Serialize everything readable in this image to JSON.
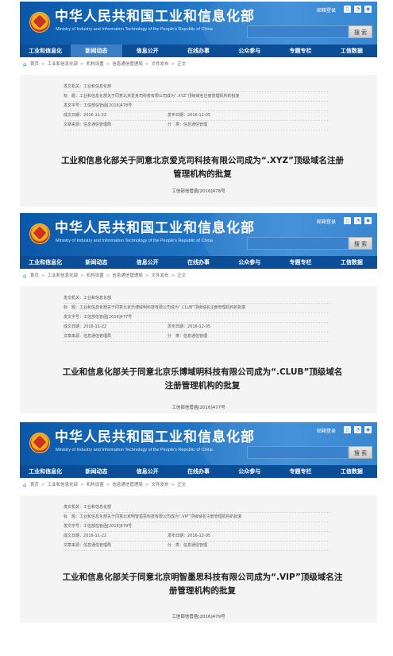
{
  "site": {
    "title": "中华人民共和国工业和信息化部",
    "subtitle": "Ministry of Industry and Information Technology of the People's Republic of China",
    "login": "邮箱登录",
    "search_label": "搜 索",
    "tool_icons": [
      "mobile-icon",
      "rss-icon",
      "weibo-icon"
    ]
  },
  "nav": {
    "items": [
      "工业和信息化",
      "新闻动态",
      "信息公开",
      "在线办事",
      "公众参与",
      "专题专栏",
      "工信数据"
    ]
  },
  "breadcrumb": [
    "首页",
    "工业和信息化部",
    "机构设置",
    "信息通信管理局",
    "文件发布",
    "正文"
  ],
  "labels": {
    "issuer": "发文机关：",
    "subject": "标　题：",
    "docnum": "发文字号：",
    "created": "成文日期：",
    "published": "发布日期：",
    "source": "文章来源：",
    "category": "分　类："
  },
  "docs": [
    {
      "issuer": "工业和信息化部",
      "subject": "工业和信息化部关于同意北京爱克司科技有限公司成为“.XYZ”顶级域名注册管理机构的批复",
      "docnum": "工信部信管函[2016]478号",
      "created": "2016-11-22",
      "published": "2016-12-05",
      "source": "信息通信管理局",
      "category": "信息通信管理",
      "title": "工业和信息化部关于同意北京爱克司科技有限公司成为“.XYZ”顶级域名注册管理机构的批复",
      "number": "工信部信管函[2016]478号"
    },
    {
      "issuer": "工业和信息化部",
      "subject": "工业和信息化部关于同意北京乐博域明科技有限公司成为“.CLUB”顶级域名注册管理机构的批复",
      "docnum": "工信部信管函[2016]477号",
      "created": "2016-11-22",
      "published": "2016-12-05",
      "source": "信息通信管理局",
      "category": "信息通信管理",
      "title": "工业和信息化部关于同意北京乐博域明科技有限公司成为“.CLUB”顶级域名注册管理机构的批复",
      "number": "工信部信管函[2016]477号"
    },
    {
      "issuer": "工业和信息化部",
      "subject": "工业和信息化部关于同意北京明智墨思科技有限公司成为“.VIP”顶级域名注册管理机构的批复",
      "docnum": "工信部信管函[2016]479号",
      "created": "2016-11-22",
      "published": "2016-12-05",
      "source": "信息通信管理局",
      "category": "信息通信管理",
      "title": "工业和信息化部关于同意北京明智墨思科技有限公司成为“.VIP”顶级域名注册管理机构的批复",
      "number": "工信部信管函[2016]479号"
    }
  ],
  "colors": {
    "header_blue": "#1f73c3",
    "nav_blue": "#0b4d96",
    "nav_active": "#3d7fc6",
    "content_bg": "#f4f4f4"
  }
}
